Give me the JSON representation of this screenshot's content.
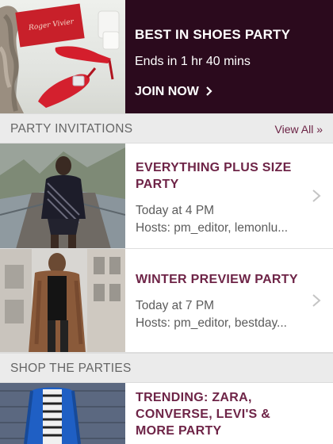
{
  "promo": {
    "title": "BEST IN SHOES PARTY",
    "subtitle": "Ends in 1 hr 40 mins",
    "cta": "JOIN NOW",
    "cta_icon": "chevron-right-icon",
    "bg_color": "#2b0a1d",
    "box_label": "Roger Vivier"
  },
  "party_invitations": {
    "header": "PARTY INVITATIONS",
    "view_all": "View All »",
    "items": [
      {
        "title": "EVERYTHING PLUS SIZE PARTY",
        "time": "Today at 4 PM",
        "hosts": "Hosts: pm_editor, lemonlu..."
      },
      {
        "title": "WINTER PREVIEW PARTY",
        "time": "Today at 7 PM",
        "hosts": "Hosts: pm_editor, bestday..."
      }
    ]
  },
  "shop_the_parties": {
    "header": "SHOP THE PARTIES",
    "items": [
      {
        "title": "TRENDING: ZARA, CONVERSE, LEVI'S & MORE PARTY"
      }
    ]
  },
  "colors": {
    "accent": "#6e2447",
    "section_bg": "#ebebeb",
    "divider": "#dedede"
  }
}
